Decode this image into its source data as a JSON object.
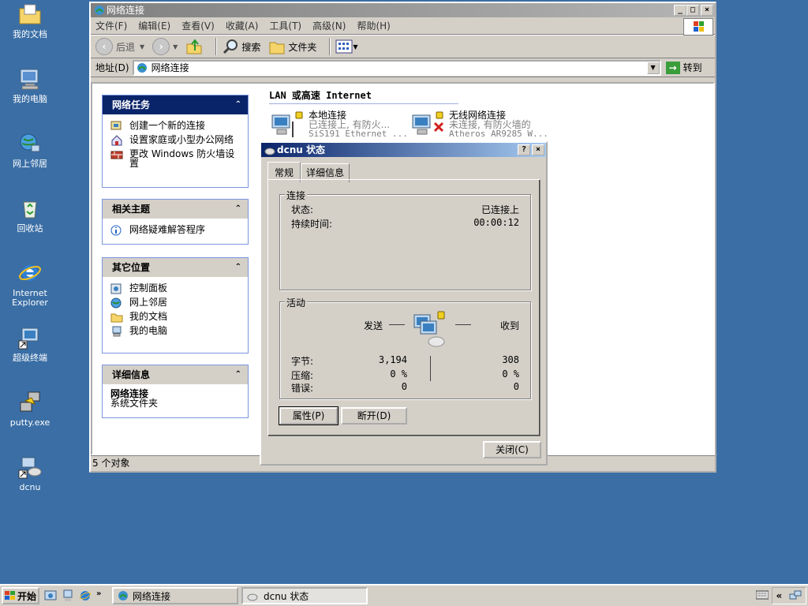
{
  "desktop": {
    "icons": [
      {
        "label": "我的文档"
      },
      {
        "label": "我的电脑"
      },
      {
        "label": "网上邻居"
      },
      {
        "label": "回收站"
      },
      {
        "label_line1": "Internet",
        "label_line2": "Explorer"
      },
      {
        "label": "超级终端"
      },
      {
        "label": "putty.exe"
      },
      {
        "label": "dcnu"
      }
    ]
  },
  "explorer": {
    "title": "网络连接",
    "menu": [
      "文件(F)",
      "编辑(E)",
      "查看(V)",
      "收藏(A)",
      "工具(T)",
      "高级(N)",
      "帮助(H)"
    ],
    "toolbar": {
      "back": "后退",
      "search": "搜索",
      "folders": "文件夹"
    },
    "address": {
      "label": "地址(D)",
      "value": "网络连接",
      "go": "转到"
    },
    "tasks_panel": {
      "title": "网络任务",
      "items": [
        "创建一个新的连接",
        "设置家庭或小型办公网络",
        "更改 Windows 防火墙设置"
      ]
    },
    "related_panel": {
      "title": "相关主题",
      "items": [
        "网络疑难解答程序"
      ]
    },
    "other_panel": {
      "title": "其它位置",
      "items": [
        "控制面板",
        "网上邻居",
        "我的文档",
        "我的电脑"
      ]
    },
    "details_panel": {
      "title": "详细信息",
      "name": "网络连接",
      "type": "系统文件夹"
    },
    "section_header": "LAN 或高速 Internet",
    "connections": [
      {
        "name": "本地连接",
        "status": "已连接上, 有防火...",
        "device": "SiS191 Ethernet ..."
      },
      {
        "name": "无线网络连接",
        "status": "未连接, 有防火墙的",
        "device": "Atheros AR9285 W..."
      }
    ],
    "status_text": "5 个对象"
  },
  "dialog": {
    "title": "dcnu 状态",
    "help_button": "?",
    "tabs": [
      "常规",
      "详细信息"
    ],
    "connection": {
      "label": "连接",
      "status_label": "状态:",
      "status_value": "已连接上",
      "duration_label": "持续时间:",
      "duration_value": "00:00:12"
    },
    "activity": {
      "label": "活动",
      "sent_label": "发送",
      "received_label": "收到",
      "rows": [
        {
          "label": "字节:",
          "sent": "3,194",
          "received": "308"
        },
        {
          "label": "压缩:",
          "sent": "0 %",
          "received": "0 %"
        },
        {
          "label": "错误:",
          "sent": "0",
          "received": "0"
        }
      ]
    },
    "buttons": {
      "properties": "属性(P)",
      "disconnect": "断开(D)",
      "close": "关闭(C)"
    }
  },
  "taskbar": {
    "start": "开始",
    "tasks": [
      {
        "label": "网络连接"
      },
      {
        "label": "dcnu 状态"
      }
    ],
    "tray_chevron": "«"
  },
  "colors": {
    "desktop": "#3a6ea5",
    "active_title": "#0a246a",
    "inactive_title": "#808080",
    "chrome": "#d4d0c8"
  }
}
